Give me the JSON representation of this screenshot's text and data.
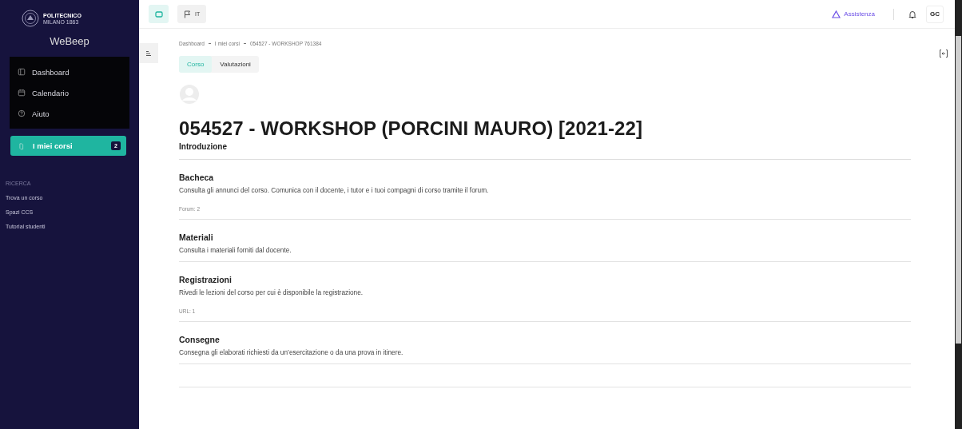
{
  "sidebar": {
    "logo": {
      "name": "POLITECNICO",
      "subtitle": "MILANO 1863"
    },
    "app_name": "WeBeep",
    "nav": [
      {
        "label": "Dashboard",
        "kind": "layout",
        "selected": false
      },
      {
        "label": "Calendario",
        "kind": "calendar",
        "selected": false
      },
      {
        "label": "Aiuto",
        "kind": "help",
        "selected": false
      }
    ],
    "courses_item": {
      "label": "I miei corsi",
      "badge": "2",
      "selected": true
    },
    "section": "RICERCA",
    "links": [
      "Trova un corso",
      "Spazi CCS",
      "Tutorial studenti"
    ]
  },
  "topbar": {
    "language": "IT",
    "assistance": "Assistenza",
    "user_initials": "GC"
  },
  "breadcrumb": [
    "Dashboard",
    "I miei corsi",
    "054527 - WORKSHOP 761384"
  ],
  "tabs": [
    {
      "label": "Corso",
      "selected": true
    },
    {
      "label": "Valutazioni",
      "selected": false
    }
  ],
  "course": {
    "title": "054527 - WORKSHOP (PORCINI MAURO) [2021-22]",
    "subtitle": "Introduzione",
    "sections": [
      {
        "title": "Bacheca",
        "description": "Consulta gli annunci del corso. Comunica con il docente, i tutor e i tuoi compagni di corso tramite il forum.",
        "meta": "Forum: 2"
      },
      {
        "title": "Materiali",
        "description": "Consulta i materiali forniti dal docente."
      },
      {
        "title": "Registrazioni",
        "description": "Rivedi le lezioni del corso per cui è disponibile la registrazione.",
        "meta": "URL: 1"
      },
      {
        "title": "Consegne",
        "description": "Consegna gli elaborati richiesti da un’esercitazione o da una prova in itinere."
      }
    ]
  }
}
